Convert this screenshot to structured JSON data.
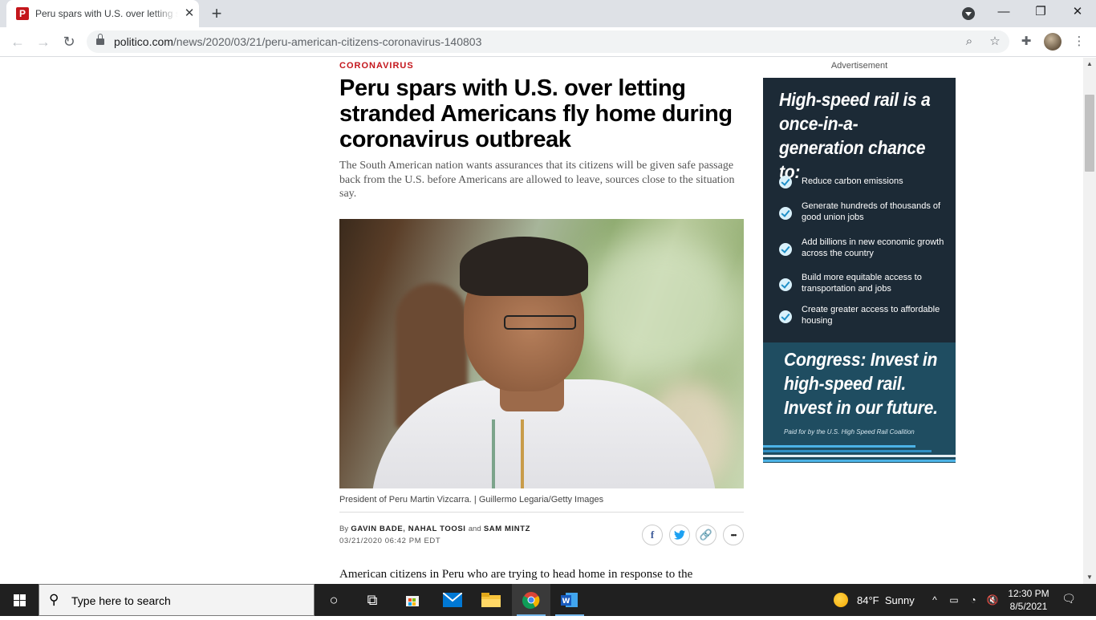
{
  "browser": {
    "tab_title": "Peru spars with U.S. over letting stranded Americans fly home during coronavirus outbreak",
    "favicon_letter": "P",
    "url_host": "politico.com",
    "url_path": "/news/2020/03/21/peru-american-citizens-coronavirus-140803",
    "icons": {
      "tab_close": "close-icon",
      "new_tab": "plus-icon",
      "back": "arrow-left-icon",
      "forward": "arrow-right-icon",
      "reload": "reload-icon",
      "lock": "lock-icon",
      "zoom": "magnifier-icon",
      "bookmark": "star-icon",
      "extensions": "puzzle-icon",
      "menu": "kebab-menu-icon",
      "minimize": "minimize-icon",
      "restore": "restore-icon",
      "close": "close-icon"
    }
  },
  "article": {
    "kicker": "CORONAVIRUS",
    "headline": "Peru spars with U.S. over letting stranded Americans fly home during coronavirus outbreak",
    "dek": "The South American nation wants assurances that its citizens will be given safe passage back from the U.S. before Americans are allowed to leave, sources close to the situation say.",
    "caption": "President of Peru Martin Vizcarra. | Guillermo Legaria/Getty Images",
    "byline_prefix": "By",
    "authors": [
      "GAVIN BADE",
      "NAHAL TOOSI",
      "SAM MINTZ"
    ],
    "byline_sep": ",",
    "byline_and": "and",
    "dateline": "03/21/2020 06:42 PM EDT",
    "share": {
      "facebook": "f",
      "more": "•••"
    },
    "body_first_line": "American citizens in Peru who are trying to head home in response to the"
  },
  "ad": {
    "label": "Advertisement",
    "headline": "High-speed rail is a once-in-a-generation chance to:",
    "items": [
      "Reduce carbon emissions",
      "Generate hundreds of thousands of good union jobs",
      "Add billions in new economic growth across the country",
      "Build more equitable access to transportation and jobs",
      "Create greater access to affordable housing"
    ],
    "cta": "Congress: Invest in high-speed rail. Invest in our future.",
    "paid_for": "Paid for by the U.S. High Speed Rail Coalition"
  },
  "taskbar": {
    "search_placeholder": "Type here to search",
    "weather_temp": "84°F",
    "weather_cond": "Sunny",
    "time": "12:30 PM",
    "date": "8/5/2021",
    "word_label": "W"
  },
  "colors": {
    "politico_red": "#c4161c",
    "ad_navy": "#1c2a36",
    "ad_teal": "#1f4d61",
    "chrome_gray": "#dee1e6"
  }
}
